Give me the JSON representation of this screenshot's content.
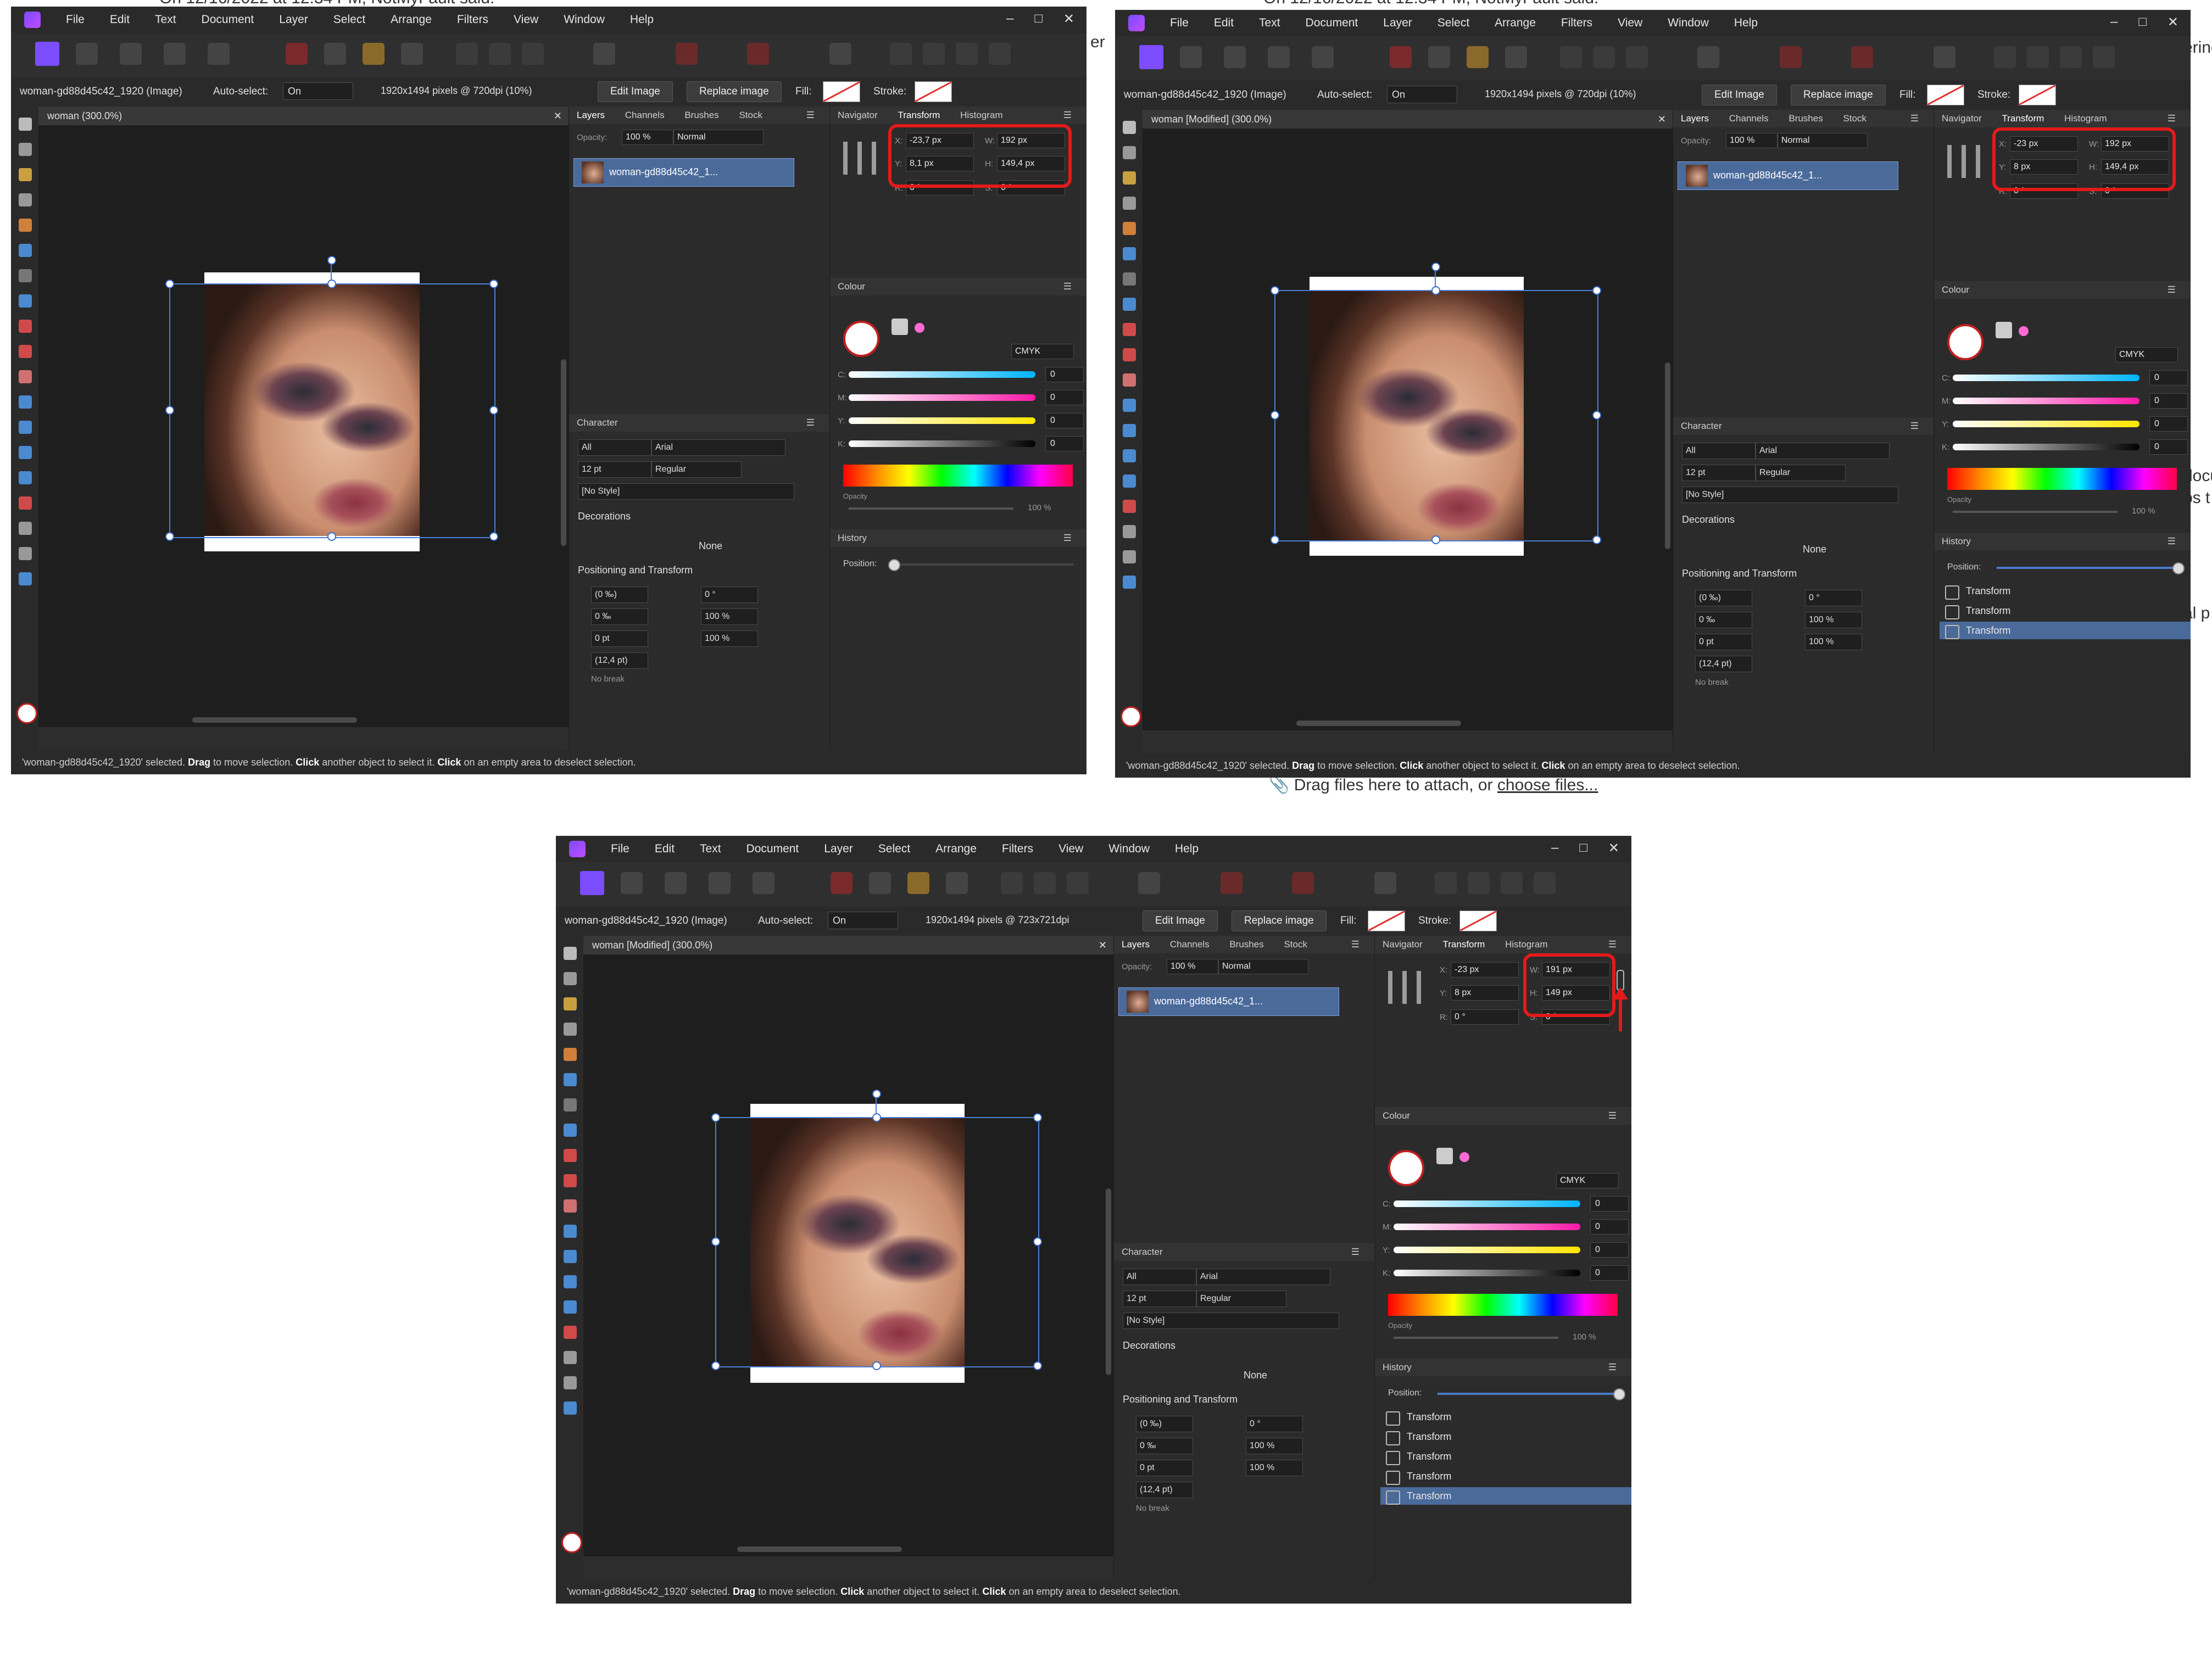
{
  "forum": {
    "top_left_text": "On 12/16/2022 at 12:34 PM, NotMyFault said:",
    "top_right_text": "On 12/16/2022 at 12:34 PM, NotMyFault said:",
    "drag_text_prefix": "Drag files here to attach, or",
    "drag_link": "choose files...",
    "side_fragments": [
      "er",
      "ering",
      "docu",
      "ps t",
      "al p"
    ]
  },
  "app": {
    "menus": [
      "File",
      "Edit",
      "Text",
      "Document",
      "Layer",
      "Select",
      "Arrange",
      "Filters",
      "View",
      "Window",
      "Help"
    ],
    "window_controls": [
      "–",
      "□",
      "✕"
    ],
    "context": {
      "layer_label": "woman-gd88d45c42_1920 (Image)",
      "autoselect_label": "Auto-select:",
      "autoselect_value": "On",
      "edit_image": "Edit Image",
      "replace_image": "Replace image",
      "fill_label": "Fill:",
      "stroke_label": "Stroke:"
    },
    "layers_panel": {
      "tabs": [
        "Layers",
        "Channels",
        "Brushes",
        "Stock"
      ],
      "opacity_label": "Opacity:",
      "opacity_value": "100 %",
      "blend_mode": "Normal",
      "layer_name": "woman-gd88d45c42_1..."
    },
    "transform_panel": {
      "tabs": [
        "Navigator",
        "Transform",
        "Histogram"
      ],
      "r_label": "R:",
      "s_label": "S:",
      "r_value": "0 °",
      "s_value": "0 °"
    },
    "colour_panel": {
      "title": "Colour",
      "mode": "CMYK",
      "channels": [
        "C:",
        "M:",
        "Y:",
        "K:"
      ],
      "values": [
        "0",
        "0",
        "0",
        "0"
      ],
      "opacity_label": "Opacity",
      "opacity_value": "100 %"
    },
    "character_panel": {
      "title": "Character",
      "scope": "All",
      "font": "Arial",
      "size": "12 pt",
      "weight": "Regular",
      "style": "[No Style]",
      "decorations": "Decorations",
      "decoration_none": "None",
      "positioning": "Positioning and Transform",
      "tracking": "(0 ‰)",
      "kerning": "0 ‰",
      "baseline": "0 pt",
      "leading": "(12,4 pt)",
      "shear": "0 °",
      "hscale": "100 %",
      "vscale": "100 %",
      "no_break": "No break"
    },
    "history_panel": {
      "title": "History",
      "position_label": "Position:",
      "item_label": "Transform"
    },
    "status": {
      "part1": "'woman-gd88d45c42_1920' selected.",
      "drag": "Drag",
      "part2": "to move selection.",
      "click1": "Click",
      "part3": "another object to select it.",
      "click2": "Click",
      "part4": "on an empty area to deselect selection."
    }
  },
  "screens": [
    {
      "doc_tab": "woman (300.0%)",
      "resolution": "1920x1494 pixels @ 720dpi (10%)",
      "x": "-23,7 px",
      "y": "8,1 px",
      "w": "192 px",
      "h": "149,4 px",
      "history_items": 0,
      "history_position": 0
    },
    {
      "doc_tab": "woman [Modified] (300.0%)",
      "resolution": "1920x1494 pixels @ 720dpi (10%)",
      "x": "-23 px",
      "y": "8 px",
      "w": "192 px",
      "h": "149,4 px",
      "history_items": 3,
      "history_position": 1.0
    },
    {
      "doc_tab": "woman [Modified] (300.0%)",
      "resolution": "1920x1494 pixels @ 723x721dpi",
      "x": "-23 px",
      "y": "8 px",
      "w": "191 px",
      "h": "149 px",
      "history_items": 5,
      "history_position": 1.0
    }
  ]
}
